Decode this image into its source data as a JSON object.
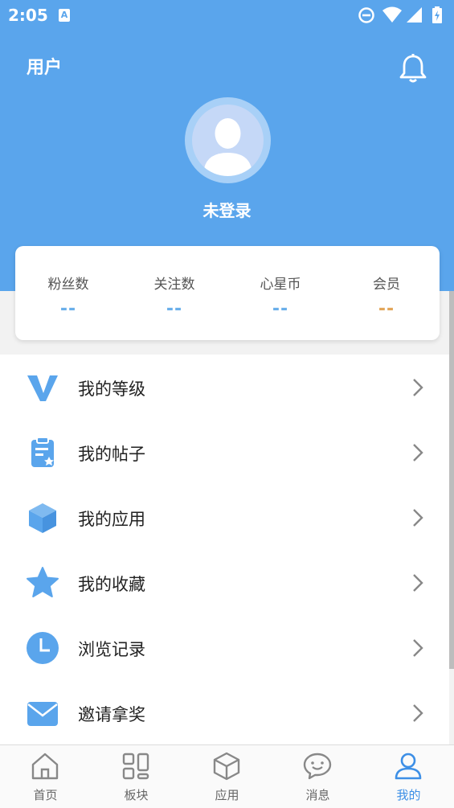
{
  "status_bar": {
    "time": "2:05",
    "notif_letter": "A"
  },
  "header": {
    "title": "用户",
    "login_text": "未登录"
  },
  "stats": [
    {
      "label": "粉丝数",
      "value": "--",
      "color": "#6aafea"
    },
    {
      "label": "关注数",
      "value": "--",
      "color": "#6aafea"
    },
    {
      "label": "心星币",
      "value": "--",
      "color": "#6aafea"
    },
    {
      "label": "会员",
      "value": "--",
      "color": "#e2a65a"
    }
  ],
  "menu": [
    {
      "label": "我的等级",
      "icon": "v-level-icon"
    },
    {
      "label": "我的帖子",
      "icon": "clipboard-star-icon"
    },
    {
      "label": "我的应用",
      "icon": "cube-icon"
    },
    {
      "label": "我的收藏",
      "icon": "star-icon"
    },
    {
      "label": "浏览记录",
      "icon": "clock-icon"
    },
    {
      "label": "邀请拿奖",
      "icon": "envelope-icon"
    }
  ],
  "tabs": [
    {
      "label": "首页",
      "icon": "home-icon"
    },
    {
      "label": "板块",
      "icon": "grid-icon"
    },
    {
      "label": "应用",
      "icon": "cube-outline-icon"
    },
    {
      "label": "消息",
      "icon": "chat-icon"
    },
    {
      "label": "我的",
      "icon": "user-icon",
      "active": true
    }
  ],
  "colors": {
    "primary": "#5aa5ec",
    "accent_gold": "#e2a65a",
    "active_tab": "#3d8fe6"
  }
}
